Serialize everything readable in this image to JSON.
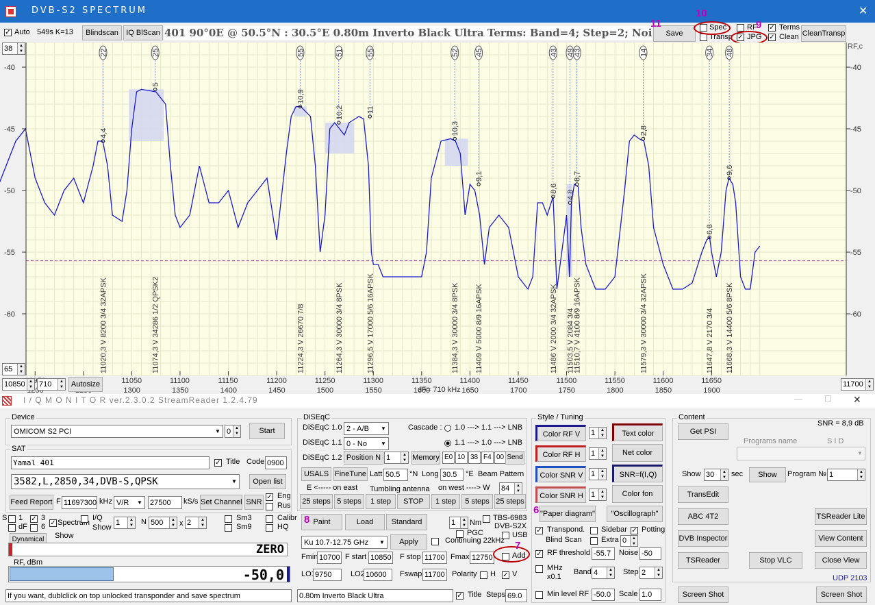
{
  "spectrum": {
    "title": "DVB-S2   SPECTRUM",
    "auto_label": "Auto",
    "auto_info": "549s  K=13",
    "blindscan": "Blindscan",
    "iq_blscan": "IQ BlScan",
    "header_text": "401   90°0E  @  50.5°N : 30.5°E    0.80m  Inverto Black Ultra     Terms:  Band=4;  Step=2;  Noise",
    "save": "Save",
    "spec": "Spec",
    "transp": "Transp",
    "rf": "RF",
    "jpg": "JPG",
    "terms": "Terms",
    "clean": "Clean",
    "cleantransp": "CleanTransp",
    "top_level": "38",
    "bottom_level": "65",
    "fstart": "10850",
    "span": "710",
    "autosize": "Autosize",
    "fend": "11700",
    "rf_right": "RF,c",
    "dF": "dF= 710 kHz",
    "annotations": {
      "n8": "8",
      "n7": "7",
      "n6": "6",
      "n9": "9",
      "n10": "10",
      "n11": "11"
    }
  },
  "chart_data": {
    "type": "line",
    "ylim": [
      -65,
      -38
    ],
    "xlim": [
      10900,
      11700
    ],
    "y_ticks": [
      -40,
      -45,
      -50,
      -55,
      -60
    ],
    "x_ticks_top": [
      10950,
      11000,
      11050,
      11100,
      11150,
      11200,
      11250,
      11300,
      11350,
      11400,
      11450,
      11500,
      11550,
      11600,
      11650
    ],
    "x_ticks_bottom": [
      1200,
      1250,
      1300,
      1350,
      1400,
      1450,
      1500,
      1550,
      1600,
      1650,
      1700,
      1750,
      1800,
      1850,
      1900
    ],
    "threshold_db": -55.7,
    "series": [
      {
        "x": [
          10900,
          10905,
          10910,
          10920,
          10930,
          10940,
          10950,
          10960,
          10970,
          10980,
          10990,
          11000,
          11010,
          11015,
          11020,
          11025,
          11030,
          11040,
          11045,
          11050,
          11055,
          11060,
          11075,
          11085,
          11090,
          11095,
          11100,
          11110,
          11120,
          11130,
          11140,
          11150,
          11160,
          11170,
          11180,
          11190,
          11200,
          11210,
          11215,
          11220,
          11225,
          11235,
          11240,
          11245,
          11250,
          11255,
          11260,
          11265,
          11270,
          11275,
          11285,
          11290,
          11295,
          11298,
          11300,
          11305,
          11310,
          11320,
          11330,
          11340,
          11350,
          11355,
          11360,
          11370,
          11380,
          11385,
          11390,
          11395,
          11400,
          11405,
          11410,
          11415,
          11420,
          11430,
          11440,
          11450,
          11460,
          11465,
          11470,
          11475,
          11480,
          11486,
          11490,
          11495,
          11500,
          11503,
          11505,
          11508,
          11512,
          11515,
          11520,
          11530,
          11540,
          11550,
          11560,
          11565,
          11570,
          11575,
          11580,
          11585,
          11590,
          11600,
          11610,
          11620,
          11630,
          11640,
          11645,
          11648,
          11650,
          11655,
          11660,
          11665,
          11668,
          11672,
          11675,
          11680,
          11685,
          11690,
          11695,
          11700
        ],
        "y": [
          -52,
          -51,
          -50,
          -48,
          -46,
          -45,
          -49,
          -51,
          -52,
          -50,
          -49,
          -51,
          -48,
          -46,
          -46,
          -48,
          -52,
          -52.5,
          -50,
          -45,
          -42,
          -41.8,
          -42,
          -43,
          -48,
          -52,
          -53,
          -52,
          -48,
          -51,
          -51,
          -50,
          -53,
          -51,
          -50,
          -49,
          -54,
          -47,
          -44,
          -43.2,
          -43.2,
          -44,
          -48,
          -55,
          -52,
          -45,
          -44.5,
          -45,
          -45.5,
          -44.5,
          -44,
          -44.2,
          -48,
          -55,
          -56,
          -56,
          -57,
          -57,
          -57,
          -57,
          -57,
          -55,
          -49,
          -46,
          -45.8,
          -46,
          -47,
          -52,
          -49.5,
          -50,
          -52,
          -56,
          -53,
          -52,
          -53,
          -57,
          -58,
          -57,
          -51,
          -51,
          -52,
          -50.5,
          -58,
          -55,
          -52,
          -57,
          -51,
          -49.5,
          -49.7,
          -53,
          -56,
          -58,
          -58,
          -57,
          -50,
          -46,
          -45.5,
          -45.8,
          -46,
          -48,
          -53,
          -56,
          -58,
          -58,
          -57.5,
          -55,
          -54,
          -53.8,
          -55,
          -57,
          -55,
          -50,
          -49,
          -49.5,
          -51,
          -57,
          -58,
          -58,
          -55,
          -54.5
        ]
      }
    ],
    "bands": [
      {
        "from": 11047,
        "to": 11083,
        "top": -41.8,
        "bottom": -46.0
      },
      {
        "from": 11218,
        "to": 11231,
        "top": -43.2,
        "bottom": -44.0
      },
      {
        "from": 11250,
        "to": 11280,
        "top": -44.5,
        "bottom": -47.0
      },
      {
        "from": 11374,
        "to": 11398,
        "top": -45.8,
        "bottom": -48.0
      },
      {
        "from": 11500,
        "to": 11506,
        "top": -49.5,
        "bottom": -57.0
      }
    ],
    "markers": [
      {
        "num": "22",
        "freq": 11020.3,
        "level": -46.0,
        "snr": "4,4",
        "label": "11020,3  V  8200 3/4 32APSK"
      },
      {
        "num": "25",
        "freq": 11074.3,
        "level": -41.8,
        "snr": "5",
        "label": "11074,3  V  34286 1/2  QPSK2"
      },
      {
        "num": "55",
        "freq": 11224.3,
        "level": -43.2,
        "snr": "10,9",
        "label": "11224,3  V  26670 7/8"
      },
      {
        "num": "51",
        "freq": 11264.3,
        "level": -44.5,
        "snr": "10,2",
        "label": "11264,3  V  30000 3/4  8PSK"
      },
      {
        "num": "55",
        "freq": 11296.5,
        "level": -44.0,
        "snr": "11",
        "label": "11296,5  V  17000 5/6 16APSK"
      },
      {
        "num": "52",
        "freq": 11384.3,
        "level": -45.8,
        "snr": "10,3",
        "label": "11384,3  V  30000 3/4  8PSK"
      },
      {
        "num": "45",
        "freq": 11409.0,
        "level": -49.5,
        "snr": "9,1",
        "label": "11409  V  5000 8/9 16APSK"
      },
      {
        "num": "43",
        "freq": 11486.0,
        "level": -50.5,
        "snr": "8,6",
        "label": "11486  V  2000 3/4 32APSK"
      },
      {
        "num": "49",
        "freq": 11503.5,
        "level": -51.0,
        "snr": "4,8",
        "label": "11503,5  V  2084 3/4"
      },
      {
        "num": "43",
        "freq": 11510.7,
        "level": -49.5,
        "snr": "8,7",
        "label": "11510,7  V  4100 8/9 16APSK"
      },
      {
        "num": "14",
        "freq": 11579.3,
        "level": -45.8,
        "snr": "2,8",
        "label": "11579,3  V  30000 3/4 32APSK"
      },
      {
        "num": "34",
        "freq": 11647.8,
        "level": -53.8,
        "snr": "6,8",
        "label": "11647,8  V  2170 3/4"
      },
      {
        "num": "48",
        "freq": 11668.3,
        "level": -49.0,
        "snr": "9,6",
        "label": "11668,3  V  14400 5/6  8PSK"
      }
    ]
  },
  "iq": {
    "title": "I / Q   M O N I T O R    ver.2.3.0.2  StreamReader 1.2.4.79",
    "device_group": "Device",
    "device": "OMICOM S2 PCI",
    "device_num": "0",
    "start": "Start",
    "sat_group": "SAT",
    "sat_name": "Yamal 401",
    "title_lbl": "Title",
    "code_lbl": "Code",
    "code": "0900",
    "tp": "3582,L,2850,34,DVB-S,QPSK",
    "open_list": "Open list",
    "feed_report": "Feed Report",
    "f_lbl": "F",
    "freq": "11697300",
    "khz": "kHz",
    "pol": "V/R",
    "sr": "27500",
    "ksps": "kS/s",
    "set_channel": "Set Channel",
    "snr_btn": "SNR",
    "eng": "Eng",
    "rus": "Rus",
    "s_lbl": "S",
    "c1": "1",
    "c3": "3",
    "df_lbl": "dF",
    "c6": "6",
    "spectrum_lbl": "Spectrum",
    "iq_lbl": "I/Q",
    "show_lbl": "Show",
    "n_lbl": "N",
    "n1": "1",
    "n500": "500",
    "x_lbl": "x",
    "x2": "2",
    "sm3": "Sm3",
    "sm9": "Sm9",
    "calibr": "Calibr",
    "hq": "HQ",
    "dynamical": "Dynamical",
    "show2": "Show",
    "zero": "ZERO",
    "rf_dbm": "RF, dBm",
    "rf_val": "-50,0",
    "status": "If you want, dublclick on top unlocked transponder and save spectrum",
    "diseqc_group": "DiSEqC",
    "d10": "DiSEqC 1.0",
    "d10v": "2 - A/B",
    "cascade": "Cascade :",
    "cas1": "1.0 ---> 1.1 ---> LNB",
    "d11": "DiSEqC 1.1",
    "d11v": "0 - No",
    "cas2": "1.1 ---> 1.0 ---> LNB",
    "d12": "DiSEqC 1.2",
    "position": "Position",
    "pos_n": "N",
    "pos_v": "1",
    "memory": "Memory",
    "e0": "E0",
    "b10": "10",
    "b38": "38",
    "f4": "F4",
    "b00": "00",
    "send": "Send",
    "usals": "USALS",
    "finetune": "FineTune",
    "latt": "Latt",
    "latt_v": "50.5",
    "n_sym": "°N",
    "long": "Long",
    "long_v": "30.5",
    "e_sym": "°E",
    "beam": "Beam Pattern",
    "east": "E  <-----  on  east",
    "tumbling": "Tumbling antenna",
    "west": "on  west  ----> W",
    "steps_v": "84",
    "s25a": "25 steps",
    "s5a": "5 steps",
    "s1a": "1 step",
    "stop": "STOP",
    "s1b": "1 step",
    "s5b": "5 steps",
    "s25b": "25 steps",
    "paint": "Paint",
    "load": "Load",
    "standard": "Standard",
    "nm_v": "1",
    "nm": "Nm",
    "tbs": "TBS-6983",
    "dvbs2x": "DVB-S2X",
    "pgc": "PGC",
    "usb": "USB",
    "band": "Ku  10.7-12.75 GHz",
    "apply": "Apply",
    "cont22": "Continuing 22kHz",
    "fmin": "Fmin",
    "fmin_v": "10700",
    "fstart": "F start",
    "fstart_v": "10850",
    "fstop": "F stop",
    "fstop_v": "11700",
    "fmax": "Fmax",
    "fmax_v": "12750",
    "add": "Add",
    "lo1": "LO1",
    "lo1_v": "9750",
    "lo2": "LO2",
    "lo2_v": "10600",
    "fswap": "Fswap",
    "fswap_v": "11700",
    "polarity": "Polarity",
    "h": "H",
    "v": "V",
    "lnb_text": "0.80m  Inverto Black Ultra",
    "title2": "Title",
    "steps": "Steps",
    "steps2_v": "69.0",
    "style_group": "Style / Tuning",
    "color_rfv": "Color  RF V",
    "color_rfh": "Color  RF H",
    "color_snrv": "Color  SNR V",
    "color_snrh": "Color  SNR H",
    "sp1": "1",
    "sp2": "1",
    "sp3": "1",
    "sp4": "1",
    "text_color": "Text color",
    "net_color": "Net color",
    "snr_f": "SNR=f(I,Q)",
    "color_fon": "Color fon",
    "paper": "\"Paper diagram\"",
    "oscill": "\"Oscillograph\"",
    "transpond": "Transpond.",
    "sidebar": "Sidebar",
    "potting": "Potting",
    "blind": "Blind  Scan",
    "extra": "Extra",
    "extra_v": "0",
    "rf_thr": "RF threshold",
    "rf_thr_v": "-55.7",
    "noise": "Noise",
    "noise_v": "-50",
    "mhz": "MHz",
    "x01": "x0.1",
    "band_lbl": "Band",
    "band_v": "4",
    "step_lbl": "Step",
    "step_v": "2",
    "min_rf": "Min level RF",
    "min_rf_v": "-50.0",
    "scale": "Scale",
    "scale_v": "1.0",
    "content_group": "Content",
    "snr_val": "SNR = 8,9 dB",
    "get_psi": "Get PSI",
    "programs_name": "Programs name",
    "sid": "S I D",
    "show_lbl3": "Show",
    "show_v": "30",
    "sec": "sec",
    "show_btn": "Show",
    "program": "Program  №",
    "prog_v": "1",
    "transedit": "TransEdit",
    "abc": "ABC 4T2",
    "tsreader_lite": "TSReader Lite",
    "dvb_insp": "DVB Inspector",
    "view_content": "View Content",
    "tsreader": "TSReader",
    "stop_vlc": "Stop VLC",
    "close_view": "Close View",
    "udp": "UDP 2103",
    "shot1": "Screen Shot",
    "shot2": "Screen Shot"
  }
}
